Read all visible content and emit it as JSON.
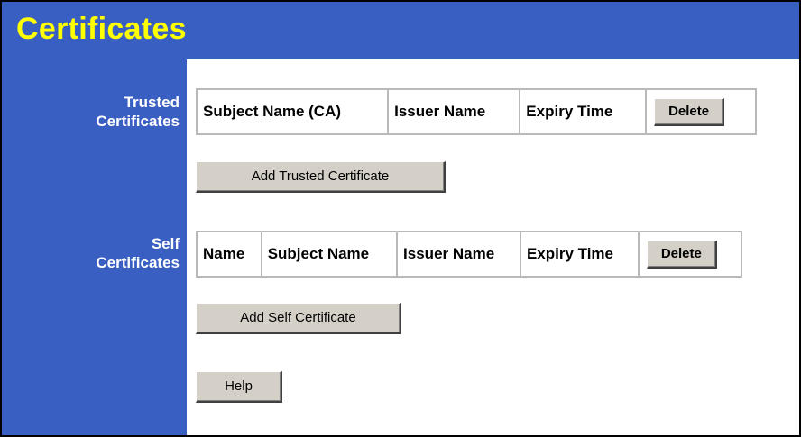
{
  "header": {
    "title": "Certificates"
  },
  "sidebar": {
    "trusted_label_line1": "Trusted",
    "trusted_label_line2": "Certificates",
    "self_label_line1": "Self",
    "self_label_line2": "Certificates"
  },
  "trusted_table": {
    "columns": [
      "Subject Name (CA)",
      "Issuer Name",
      "Expiry Time"
    ],
    "delete_label": "Delete"
  },
  "self_table": {
    "columns": [
      "Name",
      "Subject Name",
      "Issuer Name",
      "Expiry Time"
    ],
    "delete_label": "Delete"
  },
  "buttons": {
    "add_trusted": "Add Trusted Certificate",
    "add_self": "Add Self Certificate",
    "help": "Help"
  },
  "colors": {
    "header_bg": "#3a5fc3",
    "title_color": "#ffff00",
    "button_face": "#d4d0c8"
  }
}
